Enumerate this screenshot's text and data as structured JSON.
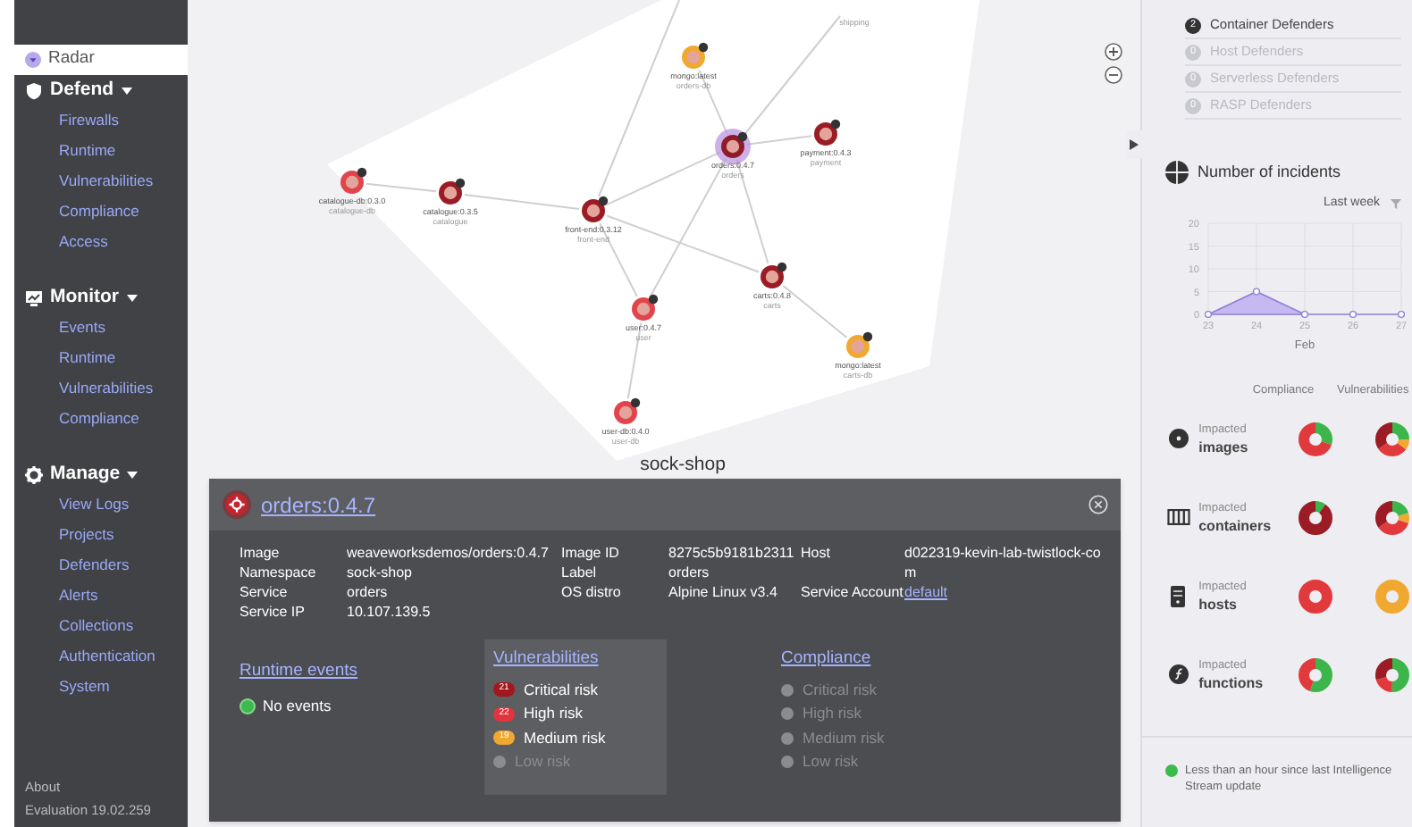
{
  "sidebar": {
    "top_item": {
      "label": "Radar",
      "selected": true
    },
    "groups": [
      {
        "label": "Defend",
        "expanded": true,
        "items": [
          "Firewalls",
          "Runtime",
          "Vulnerabilities",
          "Compliance",
          "Access"
        ]
      },
      {
        "label": "Monitor",
        "expanded": true,
        "items": [
          "Events",
          "Runtime",
          "Vulnerabilities",
          "Compliance"
        ]
      },
      {
        "label": "Manage",
        "expanded": true,
        "items": [
          "View Logs",
          "Projects",
          "Defenders",
          "Alerts",
          "Collections",
          "Authentication",
          "System"
        ]
      }
    ],
    "footer": [
      "About",
      "Evaluation 19.02.259"
    ]
  },
  "graph": {
    "offscreen_label": "shipping",
    "namespace": "sock-shop",
    "nodes": [
      {
        "name": "mongo:latest",
        "service": "orders-db",
        "color": "#f0a830",
        "selected": false
      },
      {
        "name": "orders:0.4.7",
        "service": "orders",
        "color": "#8e1b2a",
        "selected": true
      },
      {
        "name": "payment:0.4.3",
        "service": "payment",
        "color": "#9b1c24",
        "selected": false
      },
      {
        "name": "catalogue-db:0.3.0",
        "service": "catalogue-db",
        "color": "#e2444c",
        "selected": false
      },
      {
        "name": "catalogue:0.3.5",
        "service": "catalogue",
        "color": "#9b1c24",
        "selected": false
      },
      {
        "name": "front-end:0.3.12",
        "service": "front-end",
        "color": "#9b1c24",
        "selected": false
      },
      {
        "name": "user:0.4.7",
        "service": "user",
        "color": "#e2444c",
        "selected": false
      },
      {
        "name": "carts:0.4.8",
        "service": "carts",
        "color": "#9b1c24",
        "selected": false
      },
      {
        "name": "mongo:latest",
        "service": "carts-db",
        "color": "#f0a830",
        "selected": false
      },
      {
        "name": "user-db:0.4.0",
        "service": "user-db",
        "color": "#e2444c",
        "selected": false
      }
    ]
  },
  "details": {
    "title": "orders:0.4.7",
    "fields": [
      {
        "label": "Image",
        "value": "weaveworksdemos/orders:0.4.7"
      },
      {
        "label": "Namespace",
        "value": "sock-shop"
      },
      {
        "label": "Service",
        "value": "orders"
      },
      {
        "label": "Service IP",
        "value": "10.107.139.5"
      },
      {
        "label": "Image ID",
        "value": "8275c5b9181b2311"
      },
      {
        "label": "Label",
        "value": "orders"
      },
      {
        "label": "OS distro",
        "value": "Alpine Linux v3.4"
      },
      {
        "label": "Host",
        "value": "d022319-kevin-lab-twistlock-com"
      },
      {
        "label": "Service Account",
        "value": "default",
        "link": true
      }
    ],
    "runtime": {
      "title": "Runtime events",
      "status": "No events"
    },
    "vulnerabilities": {
      "title": "Vulnerabilities",
      "items": [
        {
          "count": "21",
          "label": "Critical risk",
          "color": "#a3171f",
          "disabled": false
        },
        {
          "count": "22",
          "label": "High risk",
          "color": "#e2343c",
          "disabled": false
        },
        {
          "count": "19",
          "label": "Medium risk",
          "color": "#f0a830",
          "disabled": false
        },
        {
          "label": "Low risk",
          "disabled": true
        }
      ]
    },
    "compliance": {
      "title": "Compliance",
      "items": [
        {
          "label": "Critical risk",
          "disabled": true
        },
        {
          "label": "High risk",
          "disabled": true
        },
        {
          "label": "Medium risk",
          "disabled": true
        },
        {
          "label": "Low risk",
          "disabled": true
        }
      ]
    }
  },
  "right_panel": {
    "defenders": [
      {
        "count": "2",
        "label": "Container Defenders",
        "active": true
      },
      {
        "count": "0",
        "label": "Host Defenders",
        "active": false
      },
      {
        "count": "0",
        "label": "Serverless Defenders",
        "active": false
      },
      {
        "count": "0",
        "label": "RASP Defenders",
        "active": false
      }
    ],
    "incidents": {
      "title": "Number of incidents",
      "period": "Last week",
      "chart_data": {
        "type": "area",
        "grid": true,
        "categories": [
          "23",
          "24",
          "25",
          "26",
          "27"
        ],
        "values": [
          0,
          5,
          0,
          0,
          0
        ],
        "xlabel": "Feb",
        "ylim": [
          0,
          20
        ],
        "yticks": [
          0,
          5,
          10,
          15,
          20
        ]
      }
    },
    "impact": {
      "columns": [
        "Compliance",
        "Vulnerabilities"
      ],
      "rows": [
        {
          "caption": "Impacted",
          "label": "images"
        },
        {
          "caption": "Impacted",
          "label": "containers"
        },
        {
          "caption": "Impacted",
          "label": "hosts"
        },
        {
          "caption": "Impacted",
          "label": "functions"
        }
      ]
    },
    "status": "Less than an hour since last Intelligence Stream update"
  }
}
